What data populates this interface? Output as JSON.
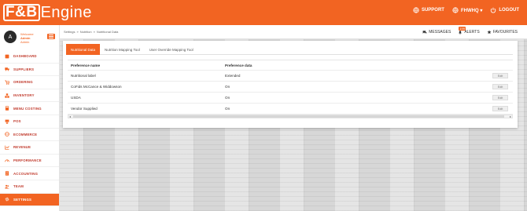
{
  "brand": {
    "logo_mark": "F&B",
    "logo_text": "Engine"
  },
  "top_actions": [
    {
      "label": "SUPPORT",
      "icon": "globe-icon"
    },
    {
      "label": "FHWHQ ▾",
      "icon": "globe-icon"
    },
    {
      "label": "LOGOUT",
      "icon": "power-icon"
    }
  ],
  "profile": {
    "initial": "A",
    "welcome": "Welcome",
    "name": "Admin",
    "role": "Admin"
  },
  "breadcrumb": [
    "Settings",
    "»",
    "Nutrition",
    "»",
    "Nutritional Data"
  ],
  "header_links": {
    "messages": "MESSAGES",
    "alerts": "ALERTS",
    "alerts_badge": "199",
    "favourites": "FAVOURITES"
  },
  "menu": [
    {
      "label": "DASHBOARD",
      "icon": "dashboard-icon"
    },
    {
      "label": "SUPPLIERS",
      "icon": "truck-icon"
    },
    {
      "label": "ORDERING",
      "icon": "cart-icon"
    },
    {
      "label": "INVENTORY",
      "icon": "boxes-icon"
    },
    {
      "label": "MENU COSTING",
      "icon": "calculator-icon"
    },
    {
      "label": "POS",
      "icon": "pos-icon"
    },
    {
      "label": "ECOMMERCE",
      "icon": "globe-icon"
    },
    {
      "label": "REVENUE",
      "icon": "chart-icon"
    },
    {
      "label": "PERFORMANCE",
      "icon": "speedometer-icon"
    },
    {
      "label": "ACCOUNTING",
      "icon": "ledger-icon"
    },
    {
      "label": "TEAM",
      "icon": "users-icon"
    },
    {
      "label": "SETTINGS",
      "icon": "gear-icon"
    }
  ],
  "tabs": [
    "Nutritional Data",
    "Nutrition Mapping Tool",
    "User Override Mapping Tool"
  ],
  "table": {
    "headers": [
      "Preference name",
      "Preference data",
      ""
    ],
    "rows": [
      {
        "name": "Nutritional label",
        "data": "Extended",
        "action": "Edit"
      },
      {
        "name": "CoFids McCance & Widdowson",
        "data": "On",
        "action": "Edit"
      },
      {
        "name": "USDA",
        "data": "On",
        "action": "Edit"
      },
      {
        "name": "Vendor Supplied",
        "data": "On",
        "action": "Edit"
      }
    ]
  },
  "colors": {
    "accent": "#f26422",
    "menu_text": "#c0392b"
  }
}
